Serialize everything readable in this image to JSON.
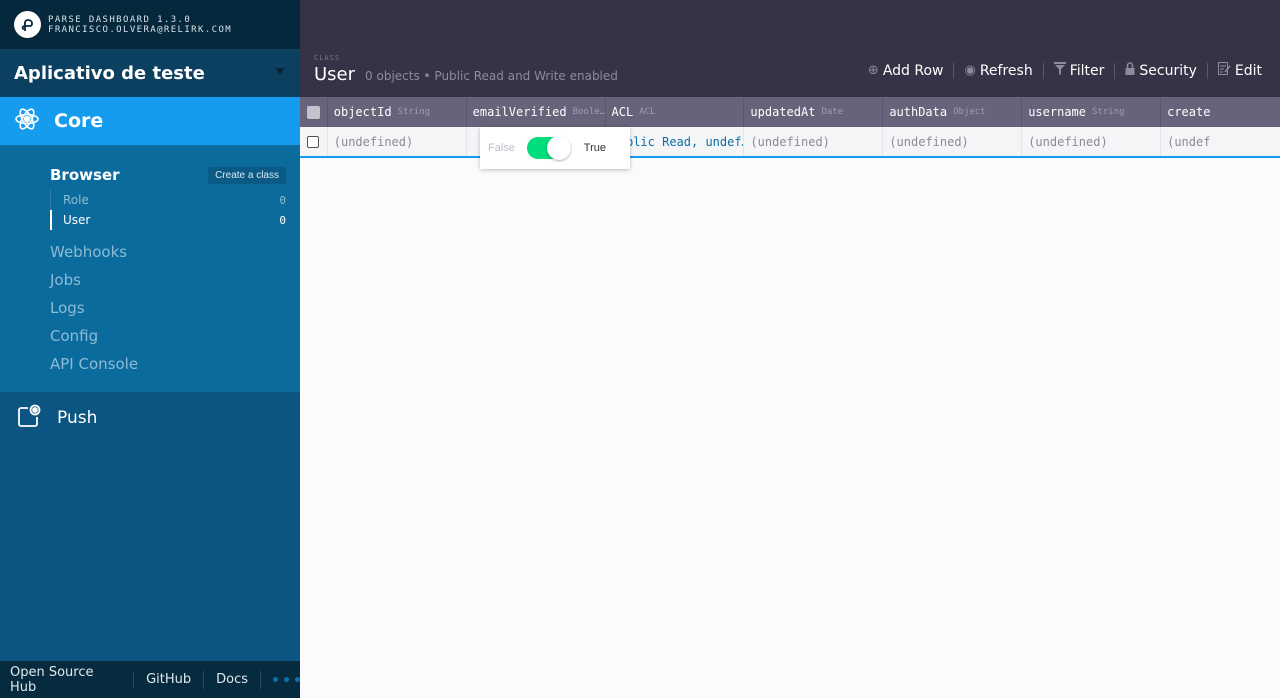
{
  "sidebar": {
    "header": {
      "title": "PARSE DASHBOARD 1.3.0",
      "user": "FRANCISCO.OLVERA@RELIRK.COM",
      "logo_icon": "parse-logo-icon"
    },
    "app_name": "Aplicativo de teste",
    "sections": {
      "core": {
        "label": "Core",
        "icon": "atom-icon"
      },
      "push": {
        "label": "Push",
        "icon": "push-notification-icon"
      }
    },
    "browser": {
      "label": "Browser",
      "create_class_label": "Create a class",
      "classes": [
        {
          "name": "Role",
          "count": "0"
        },
        {
          "name": "User",
          "count": "0"
        }
      ]
    },
    "sub_items": [
      "Webhooks",
      "Jobs",
      "Logs",
      "Config",
      "API Console"
    ],
    "footer": {
      "links": [
        "Open Source Hub",
        "GitHub",
        "Docs"
      ],
      "more_icon": "more-dots-icon"
    }
  },
  "toolbar": {
    "section_label": "CLASS",
    "class_name": "User",
    "subtitle": "0 objects • Public Read and Write enabled",
    "actions": [
      {
        "label": "Add Row",
        "icon": "plus-circle-icon"
      },
      {
        "label": "Refresh",
        "icon": "refresh-icon"
      },
      {
        "label": "Filter",
        "icon": "filter-icon"
      },
      {
        "label": "Security",
        "icon": "lock-icon"
      },
      {
        "label": "Edit",
        "icon": "edit-icon"
      }
    ]
  },
  "grid": {
    "columns": [
      {
        "name": "objectId",
        "type": "String"
      },
      {
        "name": "emailVerified",
        "type": "Boole…"
      },
      {
        "name": "ACL",
        "type": "ACL"
      },
      {
        "name": "updatedAt",
        "type": "Date"
      },
      {
        "name": "authData",
        "type": "Object"
      },
      {
        "name": "username",
        "type": "String"
      },
      {
        "name": "create",
        "type": ""
      }
    ],
    "rows": [
      [
        "(undefined)",
        "",
        "Public Read, undef…",
        "(undefined)",
        "(undefined)",
        "(undefined)",
        "(undef"
      ]
    ]
  },
  "bool_editor": {
    "false_label": "False",
    "true_label": "True",
    "value": true
  },
  "colors": {
    "accent": "#169cee",
    "toggle_on": "#00db7c",
    "toolbar_bg": "#353446",
    "sidebar_bg": "#0c5582"
  }
}
